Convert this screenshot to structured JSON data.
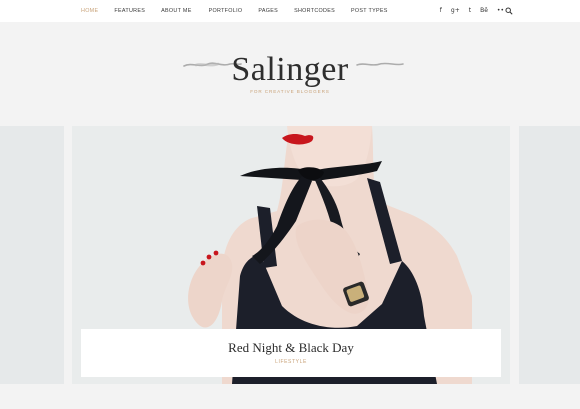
{
  "nav": {
    "items": [
      {
        "label": "HOME",
        "active": true
      },
      {
        "label": "FEATURES",
        "active": false
      },
      {
        "label": "ABOUT ME",
        "active": false
      },
      {
        "label": "PORTFOLIO",
        "active": false
      },
      {
        "label": "PAGES",
        "active": false
      },
      {
        "label": "SHORTCODES",
        "active": false
      },
      {
        "label": "POST TYPES",
        "active": false
      }
    ],
    "social": [
      {
        "icon": "facebook-icon",
        "glyph": "f"
      },
      {
        "icon": "google-plus-icon",
        "glyph": "g+"
      },
      {
        "icon": "twitter-icon",
        "glyph": "t"
      },
      {
        "icon": "behance-icon",
        "glyph": "Bē"
      },
      {
        "icon": "flickr-icon",
        "glyph": "••"
      }
    ],
    "search_icon": "search-icon"
  },
  "header": {
    "logo": "Salinger",
    "tagline": "FOR CREATIVE BLOGGERS"
  },
  "slider": {
    "post_title": "Red Night & Black Day",
    "post_category": "LIFESTYLE"
  },
  "colors": {
    "accent": "#c9a37a",
    "text_dark": "#2e2e2e",
    "background": "#f3f3f3"
  }
}
